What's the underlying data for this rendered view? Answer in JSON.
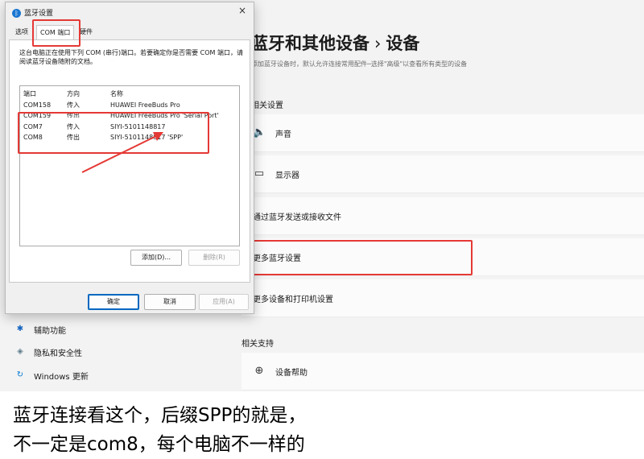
{
  "settings": {
    "title_part1": "蓝牙和其他设备",
    "title_sep": "›",
    "title_part2": "设备",
    "subtitle": "添加蓝牙设备时，默认允许连接常用配件─选择\"高级\"以查看所有类型的设备",
    "section_related_settings": "相关设置",
    "cards": [
      {
        "icon": "speaker-icon",
        "glyph": "🔈",
        "label": "声音"
      },
      {
        "icon": "monitor-icon",
        "glyph": "▭",
        "label": "显示器"
      },
      {
        "icon": "",
        "glyph": "",
        "label": "通过蓝牙发送或接收文件"
      },
      {
        "icon": "",
        "glyph": "",
        "label": "更多蓝牙设置"
      },
      {
        "icon": "",
        "glyph": "",
        "label": "更多设备和打印机设置"
      }
    ],
    "section_related_support": "相关支持",
    "support_cards": [
      {
        "icon": "globe-icon",
        "glyph": "⊕",
        "label": "设备帮助"
      }
    ],
    "nav": [
      {
        "icon": "accessibility-icon",
        "glyph": "✱",
        "label": "辅助功能",
        "color": "#1565c0"
      },
      {
        "icon": "shield-icon",
        "glyph": "◈",
        "label": "隐私和安全性",
        "color": "#607d8b"
      },
      {
        "icon": "refresh-icon",
        "glyph": "↻",
        "label": "Windows 更新",
        "color": "#0078d4"
      }
    ]
  },
  "dialog": {
    "title": "蓝牙设置",
    "close": "×",
    "tabs": [
      "选项",
      "COM 端口",
      "硬件"
    ],
    "description": "这台电脑正在使用下列 COM (串行)端口。若要确定你是否需要 COM 端口，请阅读蓝牙设备随附的文档。",
    "columns": [
      "端口",
      "方向",
      "名称"
    ],
    "rows": [
      [
        "COM158",
        "传入",
        "HUAWEI FreeBuds Pro"
      ],
      [
        "COM159",
        "传出",
        "HUAWEI FreeBuds Pro 'Serial Port'"
      ],
      [
        "COM7",
        "传入",
        "SIYI-5101148817"
      ],
      [
        "COM8",
        "传出",
        "SIYI-5101148817 'SPP'"
      ]
    ],
    "add_button": "添加(D)...",
    "remove_button": "删除(R)",
    "ok_button": "确定",
    "cancel_button": "取消",
    "apply_button": "应用(A)"
  },
  "caption": {
    "line1": "蓝牙连接看这个，后缀SPP的就是，",
    "line2": "不一定是com8，每个电脑不一样的"
  },
  "colors": {
    "highlight": "#e53935",
    "accent": "#0067c0"
  }
}
